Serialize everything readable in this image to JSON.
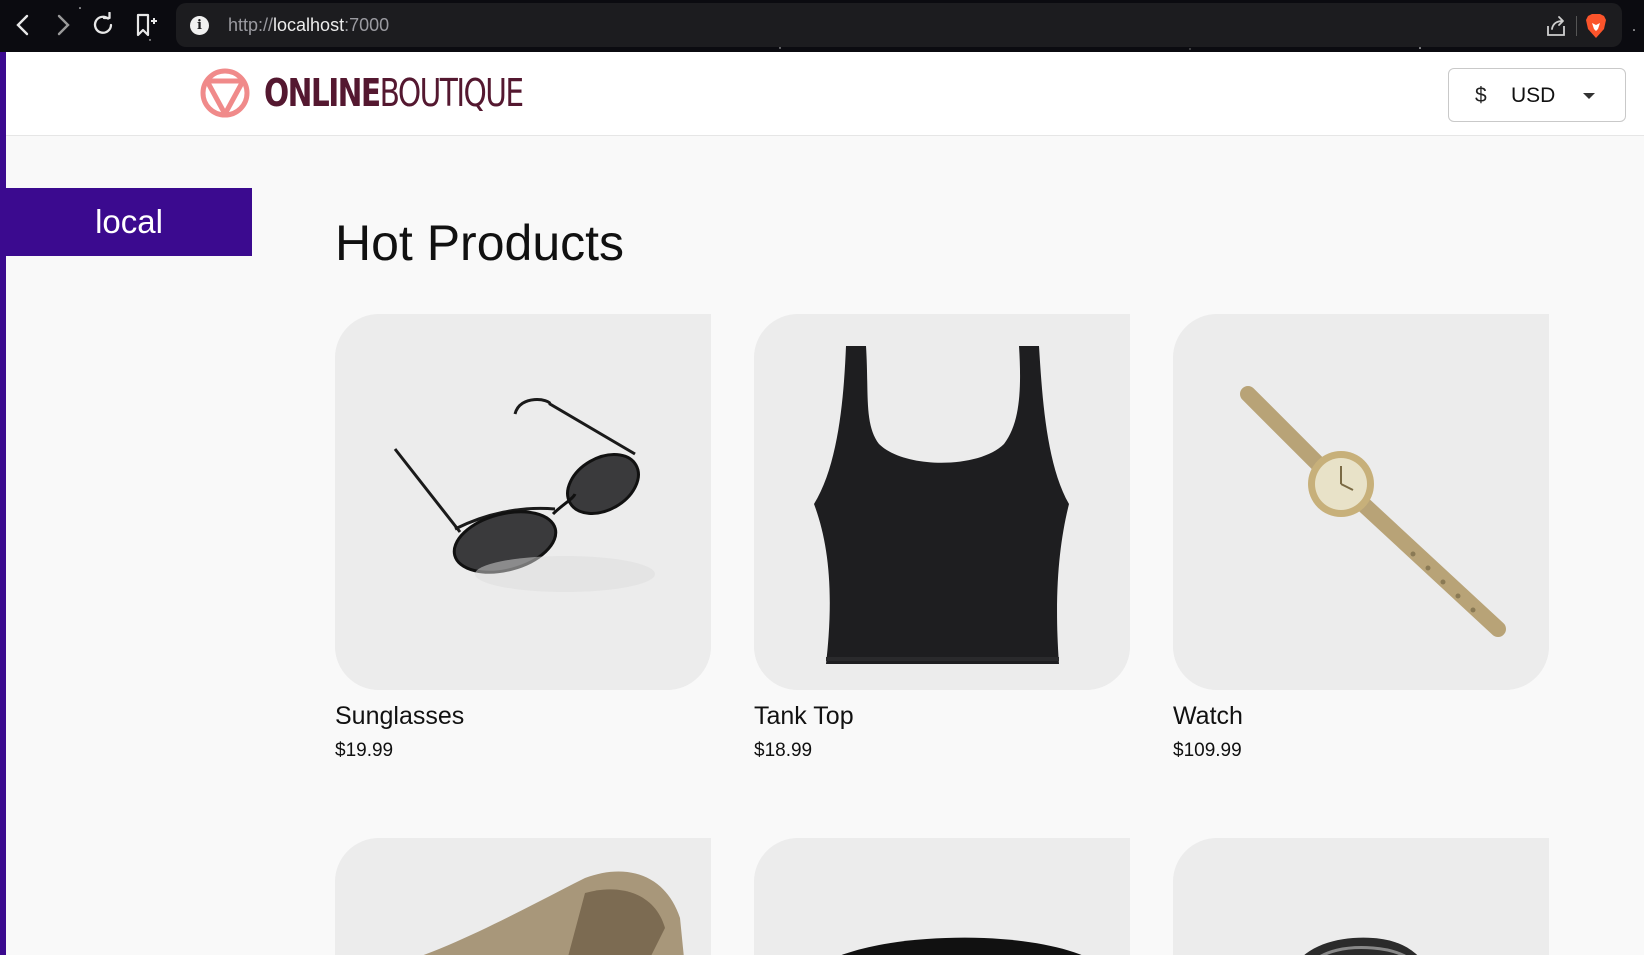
{
  "browser": {
    "url_scheme": "http://",
    "url_host": "localhost",
    "url_port": ":7000",
    "nav": {
      "back_icon": "chevron-left-icon",
      "forward_icon": "chevron-right-icon",
      "reload_icon": "reload-icon",
      "bookmark_icon": "bookmark-icon",
      "info_icon": "info-icon",
      "share_icon": "share-icon",
      "brave_icon": "brave-lion-icon"
    },
    "info_glyph": "i"
  },
  "header": {
    "logo_bold": "ONLINE",
    "logo_light": "BOUTIQUE",
    "logo_color": "#541830",
    "logo_mark_color": "#f08a8a",
    "currency": {
      "symbol": "$",
      "code": "USD"
    }
  },
  "cluster": {
    "label": "local",
    "color": "#3b0a8f"
  },
  "main": {
    "title": "Hot Products",
    "products": [
      {
        "name": "Sunglasses",
        "price": "$19.99"
      },
      {
        "name": "Tank Top",
        "price": "$18.99"
      },
      {
        "name": "Watch",
        "price": "$109.99"
      },
      {
        "name": "",
        "price": ""
      },
      {
        "name": "",
        "price": ""
      },
      {
        "name": "",
        "price": ""
      }
    ]
  }
}
